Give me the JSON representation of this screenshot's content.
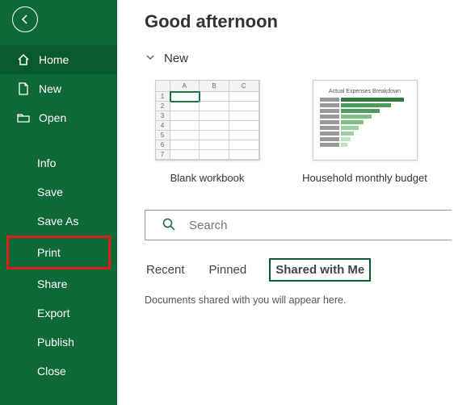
{
  "greeting": "Good afternoon",
  "sidebar": {
    "home": "Home",
    "new": "New",
    "open": "Open",
    "info": "Info",
    "save": "Save",
    "saveAs": "Save As",
    "print": "Print",
    "share": "Share",
    "export": "Export",
    "publish": "Publish",
    "close": "Close"
  },
  "section": {
    "new": "New"
  },
  "templates": {
    "blank": "Blank workbook",
    "budget": "Household monthly budget",
    "budgetThumbTitle": "Actual Expenses Breakdown",
    "cols": {
      "a": "A",
      "b": "B",
      "c": "C"
    },
    "rows": {
      "r1": "1",
      "r2": "2",
      "r3": "3",
      "r4": "4",
      "r5": "5",
      "r6": "6",
      "r7": "7"
    }
  },
  "search": {
    "placeholder": "Search"
  },
  "tabs": {
    "recent": "Recent",
    "pinned": "Pinned",
    "shared": "Shared with Me"
  },
  "emptyMsg": "Documents shared with you will appear here."
}
